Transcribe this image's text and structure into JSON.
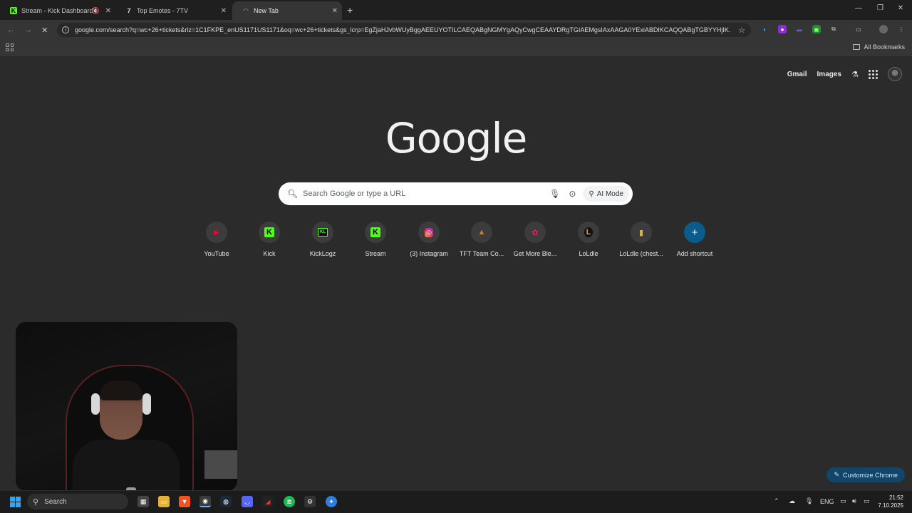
{
  "tabs": [
    {
      "label": "Stream - Kick Dashboard",
      "favicon": "kick-icon",
      "active": false
    },
    {
      "label": "Top Emotes - 7TV",
      "favicon": "7tv-icon",
      "active": false
    },
    {
      "label": "New Tab",
      "favicon": "loading-icon",
      "active": true
    }
  ],
  "omnibox": {
    "url": "google.com/search?q=wc+26+tickets&rlz=1C1FKPE_enUS1171US1171&oq=wc+26+tickets&gs_lcrp=EgZjaHJvbWUyBggAEEUYOTILCAEQABgNGMYgAQyCwgCEAAYDRgTGIAEMgsIAxAAGA0YExiABDIKCAQQABgTGBYYHjIK..."
  },
  "bookmarks": {
    "all_label": "All Bookmarks"
  },
  "google": {
    "logo": "Google",
    "gmail": "Gmail",
    "images": "Images",
    "search_placeholder": "Search Google or type a URL",
    "ai_mode": "AI Mode"
  },
  "shortcuts": [
    {
      "label": "YouTube",
      "icon": "youtube-icon",
      "color": "#ff0033",
      "glyph": "▶"
    },
    {
      "label": "Kick",
      "icon": "kick-icon",
      "color": "#53fc18",
      "glyph": "K"
    },
    {
      "label": "KickLogz",
      "icon": "kicklogz-icon",
      "color": "#53fc18",
      "glyph": "KL"
    },
    {
      "label": "Stream",
      "icon": "kick-icon",
      "color": "#53fc18",
      "glyph": "K"
    },
    {
      "label": "(3) Instagram",
      "icon": "instagram-icon",
      "color": "#e1306c",
      "glyph": "◎"
    },
    {
      "label": "TFT Team Co...",
      "icon": "tft-icon",
      "color": "#c0863a",
      "glyph": "▲"
    },
    {
      "label": "Get More Ble...",
      "icon": "bloons-icon",
      "color": "#e0245e",
      "glyph": "✿"
    },
    {
      "label": "LoLdle",
      "icon": "loldle-icon",
      "color": "#c9a45c",
      "glyph": "L"
    },
    {
      "label": "LoLdle (chest...",
      "icon": "loldle-chest-icon",
      "color": "#d4b24a",
      "glyph": "▮"
    },
    {
      "label": "Add shortcut",
      "icon": "plus-icon",
      "color": "#0b5b8c",
      "glyph": "+"
    }
  ],
  "customize": {
    "label": "Customize Chrome"
  },
  "taskbar": {
    "search": "Search",
    "lang": "ENG",
    "time": "21:52",
    "date": "7.10.2025"
  }
}
